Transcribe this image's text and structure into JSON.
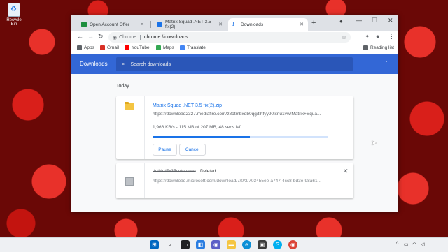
{
  "desktop": {
    "recycle_bin_label": "Recycle Bin"
  },
  "browser": {
    "tabs": [
      {
        "title": "Open Account Offer",
        "favicon_color": "#1e8e3e"
      },
      {
        "title": "Matrix Squad .NET 3.5 fix(2)",
        "favicon_color": "#1a73e8"
      },
      {
        "title": "Downloads",
        "favicon_color": "#1a73e8",
        "active": true
      }
    ],
    "new_tab_label": "+",
    "address_chip": "Chrome",
    "address_url": "chrome://downloads",
    "bookmarks": [
      {
        "label": "Apps",
        "icon_color": "#5f6368"
      },
      {
        "label": "Gmail",
        "icon_color": "#d93025"
      },
      {
        "label": "YouTube",
        "icon_color": "#ff0000"
      },
      {
        "label": "Maps",
        "icon_color": "#34a853"
      },
      {
        "label": "Translate",
        "icon_color": "#4285f4"
      }
    ],
    "reading_list": "Reading list"
  },
  "downloads": {
    "header_title": "Downloads",
    "search_placeholder": "Search downloads",
    "section_label": "Today",
    "active_item": {
      "file_name": "Matrix Squad .NET 3.5 fix(2).zip",
      "url": "https://download2327.mediafire.com/z8otmbxqb0qg/tlhfyy90ixnu1vw/Matrix+Squa...",
      "progress_text": "1,966 KB/s - 115 MB of 207 MB, 48 secs left",
      "progress_fraction": 0.555,
      "pause_label": "Pause",
      "cancel_label": "Cancel"
    },
    "deleted_item": {
      "file_name": "dotNetFx35setup.exe",
      "status": "Deleted",
      "url": "https://download.microsoft.com/download/7/0/3/703455ee-a747-4cc8-bd3e-98a61..."
    }
  },
  "colors": {
    "accent": "#3367d6",
    "link": "#1a73e8"
  }
}
